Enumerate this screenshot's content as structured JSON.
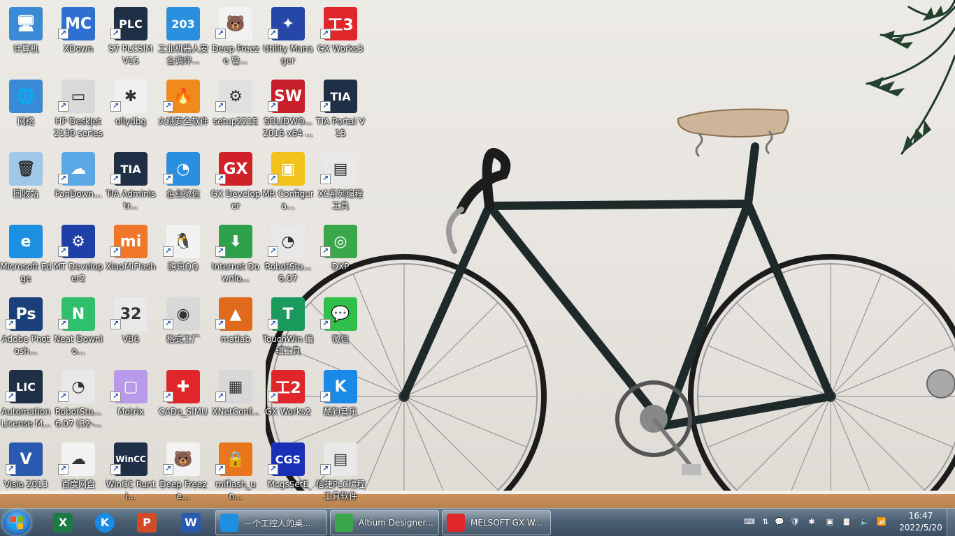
{
  "desktop": {
    "icons": [
      {
        "label": "计算机",
        "glyph": "🖥",
        "bg": "#3a8ad6",
        "shortcut": false
      },
      {
        "label": "XDown",
        "glyph": "MC",
        "bg": "#2f6fd1",
        "shortcut": true
      },
      {
        "label": "S7 PLCSIM V15",
        "glyph": "PLC",
        "bg": "#1f2f45",
        "shortcut": true
      },
      {
        "label": "工业机器人安全调评...",
        "glyph": "203",
        "bg": "#2b8fe0",
        "shortcut": false
      },
      {
        "label": "Deep Freeze 管...",
        "glyph": "🐻",
        "bg": "#f2f2f2",
        "shortcut": true
      },
      {
        "label": "Utility Manager",
        "glyph": "✦",
        "bg": "#2747a8",
        "shortcut": true
      },
      {
        "label": "GX Works3",
        "glyph": "工3",
        "bg": "#e0262b",
        "shortcut": true
      },
      {
        "label": "网络",
        "glyph": "🌐",
        "bg": "#3a8ad6",
        "shortcut": false
      },
      {
        "label": "HP DeskJet 2130 series",
        "glyph": "▭",
        "bg": "#d9d9d9",
        "shortcut": true
      },
      {
        "label": "ollydbg",
        "glyph": "✱",
        "bg": "#f0f0f0",
        "shortcut": true
      },
      {
        "label": "火绒安全软件",
        "glyph": "🔥",
        "bg": "#f08a1c",
        "shortcut": true
      },
      {
        "label": "setup221E",
        "glyph": "⚙",
        "bg": "#e0e0e0",
        "shortcut": true
      },
      {
        "label": "SOLIDWO... 2016 x64 ...",
        "glyph": "SW",
        "bg": "#c8202a",
        "shortcut": true
      },
      {
        "label": "TIA Portal V15",
        "glyph": "TIA",
        "bg": "#1f2f45",
        "shortcut": true
      },
      {
        "label": "回收站",
        "glyph": "🗑",
        "bg": "#9fc7e8",
        "shortcut": false
      },
      {
        "label": "PanDown...",
        "glyph": "☁",
        "bg": "#5aa8e6",
        "shortcut": true
      },
      {
        "label": "TIA Administr...",
        "glyph": "TIA",
        "bg": "#1f2f45",
        "shortcut": true
      },
      {
        "label": "企业微信",
        "glyph": "◔",
        "bg": "#2b8fe0",
        "shortcut": true
      },
      {
        "label": "GX Developer",
        "glyph": "GX",
        "bg": "#d02028",
        "shortcut": true
      },
      {
        "label": "MR Configura...",
        "glyph": "▣",
        "bg": "#f0c21a",
        "shortcut": true
      },
      {
        "label": "XC系列编程工具",
        "glyph": "▤",
        "bg": "#e8e8e8",
        "shortcut": true
      },
      {
        "label": "Microsoft Edge",
        "glyph": "e",
        "bg": "#1d8fe0",
        "shortcut": false
      },
      {
        "label": "MT Developer2",
        "glyph": "⚙",
        "bg": "#1f3fa8",
        "shortcut": true
      },
      {
        "label": "XiaoMiFlash",
        "glyph": "mi",
        "bg": "#f0772a",
        "shortcut": true
      },
      {
        "label": "腾讯QQ",
        "glyph": "🐧",
        "bg": "#f2f2f2",
        "shortcut": true
      },
      {
        "label": "Internet Downlo...",
        "glyph": "⬇",
        "bg": "#2ca04a",
        "shortcut": true
      },
      {
        "label": "RobotStu... 6.07",
        "glyph": "◔",
        "bg": "#e8e8e8",
        "shortcut": true
      },
      {
        "label": "DXP",
        "glyph": "◎",
        "bg": "#3aa84a",
        "shortcut": true
      },
      {
        "label": "Adobe Photosh...",
        "glyph": "Ps",
        "bg": "#1a3f7a",
        "shortcut": true
      },
      {
        "label": "Neat Downlo...",
        "glyph": "N",
        "bg": "#2ec06a",
        "shortcut": true
      },
      {
        "label": "VB6",
        "glyph": "32",
        "bg": "#e8e8e8",
        "shortcut": true
      },
      {
        "label": "格式工厂",
        "glyph": "◉",
        "bg": "#d8d8d8",
        "shortcut": true
      },
      {
        "label": "matlab",
        "glyph": "▲",
        "bg": "#e06a1c",
        "shortcut": true
      },
      {
        "label": "TouchWin 编辑工具",
        "glyph": "T",
        "bg": "#1a9a5a",
        "shortcut": true
      },
      {
        "label": "微信",
        "glyph": "💬",
        "bg": "#2fbf4a",
        "shortcut": true
      },
      {
        "label": "Automation License M...",
        "glyph": "LIC",
        "bg": "#1f2f45",
        "shortcut": true
      },
      {
        "label": "RobotStu... 6.07 (32-...",
        "glyph": "◔",
        "bg": "#e8e8e8",
        "shortcut": true
      },
      {
        "label": "Motrix",
        "glyph": "▢",
        "bg": "#b89ae8",
        "shortcut": true
      },
      {
        "label": "CADe_SIMU",
        "glyph": "✚",
        "bg": "#e0262b",
        "shortcut": true
      },
      {
        "label": "XNetConf...",
        "glyph": "▦",
        "bg": "#d8d8d8",
        "shortcut": true
      },
      {
        "label": "GX Works2",
        "glyph": "工2",
        "bg": "#e0262b",
        "shortcut": true
      },
      {
        "label": "酷狗音乐",
        "glyph": "K",
        "bg": "#1a8ae8",
        "shortcut": true
      },
      {
        "label": "Visio 2013",
        "glyph": "V",
        "bg": "#2a5ab0",
        "shortcut": true
      },
      {
        "label": "百度网盘",
        "glyph": "☁",
        "bg": "#f2f2f2",
        "shortcut": true
      },
      {
        "label": "WinCC Runti...",
        "glyph": "WinCC",
        "bg": "#1f2f45",
        "shortcut": true
      },
      {
        "label": "Deep Freeze...",
        "glyph": "🐻",
        "bg": "#f2f2f2",
        "shortcut": true
      },
      {
        "label": "miflash_un...",
        "glyph": "🔒",
        "bg": "#e8761c",
        "shortcut": true
      },
      {
        "label": "McgsSetE",
        "glyph": "CGS",
        "bg": "#1a2fb8",
        "shortcut": true
      },
      {
        "label": "信捷PLC编程工具软件",
        "glyph": "▤",
        "bg": "#e8e8e8",
        "shortcut": true
      }
    ]
  },
  "taskbar": {
    "pinned": [
      {
        "name": "excel",
        "glyph": "X",
        "bg": "#1d7a45"
      },
      {
        "name": "kugou",
        "glyph": "K",
        "bg": "#1a8ae8"
      },
      {
        "name": "powerpoint",
        "glyph": "P",
        "bg": "#d24a26"
      },
      {
        "name": "word",
        "glyph": "W",
        "bg": "#2a5ab0"
      }
    ],
    "windows": [
      {
        "label": "一个工控人的桌...",
        "icon_bg": "#1d8fe0",
        "active": false
      },
      {
        "label": "Altium Designer...",
        "icon_bg": "#3aa84a",
        "active": false
      },
      {
        "label": "MELSOFT GX W...",
        "icon_bg": "#e0262b",
        "active": false
      }
    ],
    "tray": [
      "⌨",
      "⇅",
      "💬",
      "🛡",
      "✱",
      "▣",
      "📋",
      "🔈",
      "📶"
    ],
    "clock": {
      "time": "16:47",
      "date": "2022/5/20"
    }
  }
}
